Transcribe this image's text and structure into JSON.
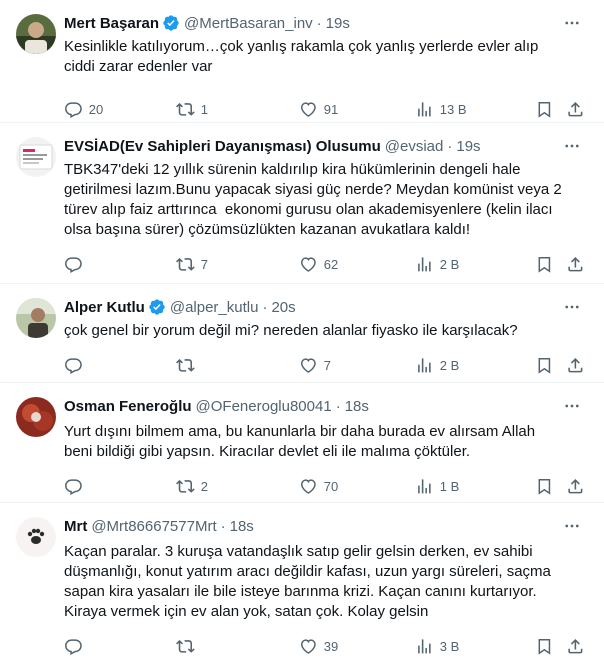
{
  "tweets": [
    {
      "name": "Mert Başaran",
      "verified": true,
      "handle": "@MertBasaran_inv",
      "time": "19s",
      "text": "Kesinlikle katılıyorum…çok yanlış rakamla çok yanlış yerlerde evler alıp ciddi zarar edenler var",
      "replies": "20",
      "retweets": "1",
      "likes": "91",
      "views": "13 B"
    },
    {
      "name": "EVSİAD(Ev Sahipleri Dayanışması) Olusumu",
      "verified": false,
      "handle": "@evsiad",
      "time": "19s",
      "text": "TBK347'deki 12 yıllık sürenin kaldırılıp kira hükümlerinin dengeli hale getirilmesi lazım.Bunu yapacak siyasi güç nerde? Meydan komünist veya 2 türev alıp faiz arttırınca  ekonomi gurusu olan akademisyenlere (kelin ilacı olsa başına sürer) çözümsüzlükten kazanan avukatlara kaldı!",
      "replies": "",
      "retweets": "7",
      "likes": "62",
      "views": "2 B"
    },
    {
      "name": "Alper Kutlu",
      "verified": true,
      "handle": "@alper_kutlu",
      "time": "20s",
      "text": "çok genel bir yorum değil mi? nereden alanlar fiyasko ile karşılacak?",
      "replies": "",
      "retweets": "",
      "likes": "7",
      "views": "2 B"
    },
    {
      "name": "Osman Feneroğlu",
      "verified": false,
      "handle": "@OFeneroglu80041",
      "time": "18s",
      "text": "Yurt dışını bilmem ama, bu kanunlarla bir daha burada ev alırsam Allah beni bildiği gibi yapsın. Kiracılar devlet eli ile malıma çöktüler.",
      "replies": "",
      "retweets": "2",
      "likes": "70",
      "views": "1 B"
    },
    {
      "name": "Mrt",
      "verified": false,
      "handle": "@Mrt86667577Mrt",
      "time": "18s",
      "text": "Kaçan paralar. 3 kuruşa vatandaşlık satıp gelir gelsin derken, ev sahibi düşmanlığı, konut yatırım aracı değildir kafası, uzun yargı süreleri, saçma sapan kira yasaları ile bile isteye barınma krizi. Kaçan canını kurtarıyor. Kiraya vermek için ev alan yok, satan çok. Kolay gelsin",
      "replies": "",
      "retweets": "",
      "likes": "39",
      "views": "3 B"
    }
  ],
  "dot": "·",
  "colors": {
    "verified": "#1d9bf0",
    "muted": "#536471",
    "text": "#0f1419",
    "divider": "#eff3f4"
  }
}
